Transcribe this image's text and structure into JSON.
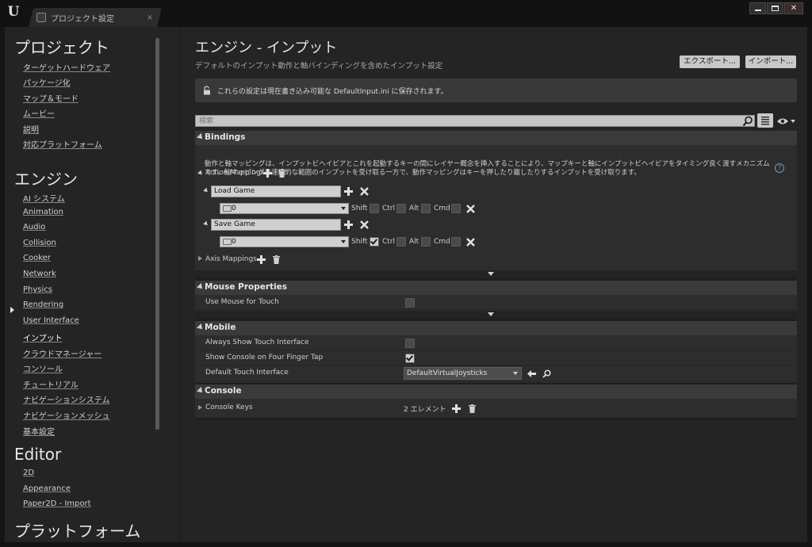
{
  "window": {
    "tab_label": "プロジェクト設定",
    "tab_close": "×"
  },
  "sidebar": {
    "categories": [
      {
        "label": "プロジェクト",
        "items": [
          "ターゲットハードウェア",
          "パッケージ化",
          "マップ＆モード",
          "ムービー",
          "説明",
          "対応プラットフォーム"
        ]
      },
      {
        "label": "エンジン",
        "items": [
          "AI システム",
          "Animation",
          "Audio",
          "Collision",
          "Cooker",
          "Network",
          "Physics",
          "Rendering",
          "User Interface",
          "インプット",
          "クラウドマネージャー",
          "コンソール",
          "チュートリアル",
          "ナビゲーションシステム",
          "ナビゲーションメッシュ",
          "基本設定"
        ]
      },
      {
        "label": "Editor",
        "items": [
          "2D",
          "Appearance",
          "Paper2D - Import"
        ]
      },
      {
        "label": "プラットフォーム",
        "items": []
      }
    ],
    "active_item": "インプット"
  },
  "main": {
    "title": "エンジン - インプット",
    "subtitle": "デフォルトのインプット動作と軸バインディングを含めたインプット設定",
    "export_label": "エクスポート...",
    "import_label": "インポート...",
    "info_text": "これらの設定は現在書き込み可能な DefaultInput.ini に保存されます。",
    "search_placeholder": "検索"
  },
  "details": {
    "bindings": {
      "label": "Bindings",
      "description": "動作と軸マッピングは、インプットビヘイビアとこれを起動するキーの間にレイヤー概念を挿入することにより、マップキーと軸にインプットビヘイビアをタイミング良く渡すメカニズムです。軸マッピングは連続的な範囲のインプットを受け取る一方で、動作マッピングはキーを押したり離したりするインプットを受け取ります。",
      "help": "?",
      "action_mappings_label": "Action Mappings",
      "actions": [
        {
          "name": "Load Game",
          "key": "0",
          "shift": false,
          "ctrl": false,
          "alt": false,
          "cmd": false
        },
        {
          "name": "Save Game",
          "key": "0",
          "shift": true,
          "ctrl": false,
          "alt": false,
          "cmd": false
        }
      ],
      "mod_labels": {
        "shift": "Shift",
        "ctrl": "Ctrl",
        "alt": "Alt",
        "cmd": "Cmd"
      },
      "axis_mappings_label": "Axis Mappings"
    },
    "mouse": {
      "label": "Mouse Properties",
      "use_mouse_for_touch_label": "Use Mouse for Touch",
      "use_mouse_for_touch": false
    },
    "mobile": {
      "label": "Mobile",
      "always_show_touch_label": "Always Show Touch Interface",
      "always_show_touch": false,
      "show_console_label": "Show Console on Four Finger Tap",
      "show_console": true,
      "default_touch_label": "Default Touch Interface",
      "default_touch_value": "DefaultVirtualJoysticks"
    },
    "console": {
      "label": "Console",
      "console_keys_label": "Console Keys",
      "console_keys_value": "2 エレメント"
    }
  }
}
